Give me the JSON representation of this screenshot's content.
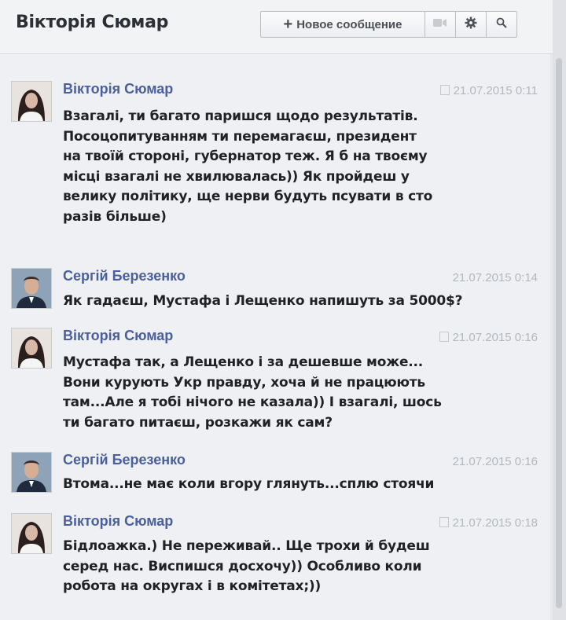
{
  "header": {
    "title": "Вікторія Сюмар",
    "new_message_label": "Новое сообщение",
    "icons": [
      "video-icon",
      "gear-icon",
      "search-icon"
    ]
  },
  "messages": [
    {
      "author": "Вікторія Сюмар",
      "time": "21.07.2015 0:11",
      "lines": [
        "Взагалі, ти багато паришся щодо результатів.",
        "Посоцопитуванням ти перемагаєш, президент",
        "на твоїй стороні, губернатор теж. Я б на твоєму",
        "місці взагалі не хвилювалась)) Як пройдеш у",
        "велику політику, ще нерви будуть псувати в сто",
        "разів більше)"
      ]
    },
    {
      "author": "Сергій Березенко",
      "time": "21.07.2015 0:14",
      "lines": [
        "Як гадаєш, Мустафа і Лещенко напишуть за 5000$?"
      ]
    },
    {
      "author": "Вікторія Сюмар",
      "time": "21.07.2015 0:16",
      "lines": [
        "Мустафа так, а Лещенко і за дешевше може...",
        "Вони курують Укр правду, хоча й не працюють",
        "там...Але я тобі нічого не казала)) І взагалі, шось",
        "ти багато питаєш, розкажи як сам?"
      ]
    },
    {
      "author": "Сергій Березенко",
      "time": "21.07.2015 0:16",
      "lines": [
        "Втома...не має коли вгору глянуть...сплю стоячи"
      ]
    },
    {
      "author": "Вікторія Сюмар",
      "time": "21.07.2015 0:18",
      "lines": [
        "Бідлоажка.) Не переживай.. Ще трохи й будеш",
        "серед нас. Виспишся досхочу)) Особливо коли",
        "робота на округах і в комітетах;))"
      ]
    }
  ]
}
